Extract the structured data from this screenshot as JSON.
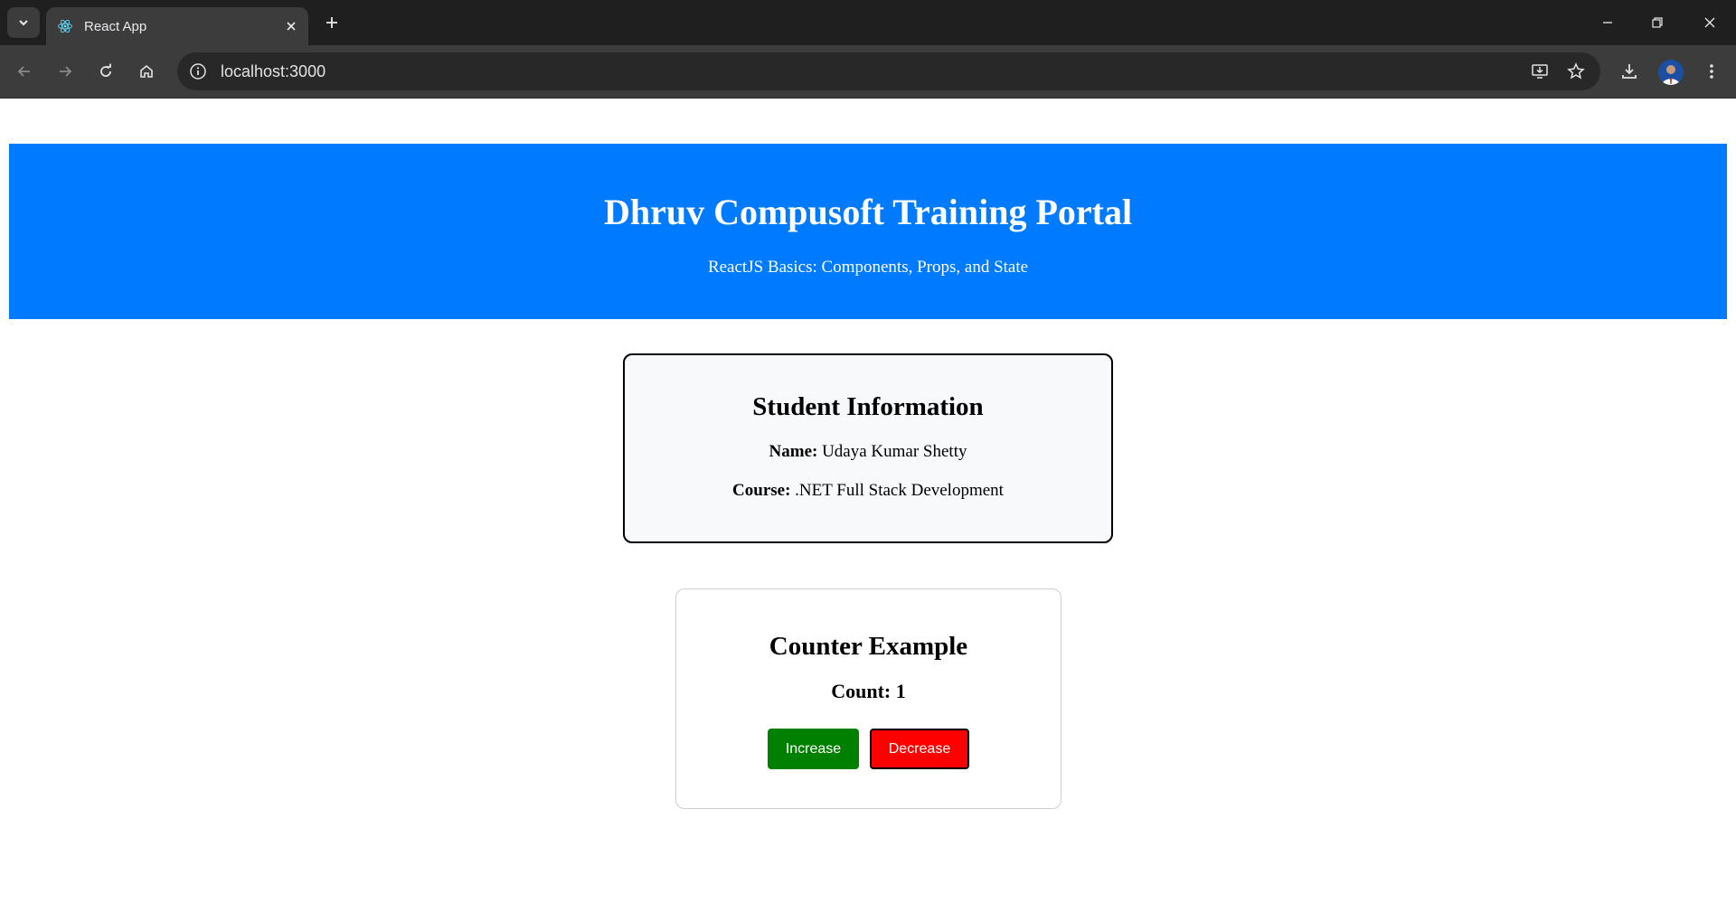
{
  "browser": {
    "tab_title": "React App",
    "url": "localhost:3000"
  },
  "header": {
    "title": "Dhruv Compusoft Training Portal",
    "subtitle": "ReactJS Basics: Components, Props, and State",
    "bg_color": "#007bff"
  },
  "student": {
    "heading": "Student Information",
    "name_label": "Name:",
    "name_value": "Udaya Kumar Shetty",
    "course_label": "Course:",
    "course_value": ".NET Full Stack Development"
  },
  "counter": {
    "heading": "Counter Example",
    "count_text": "Count: 1",
    "increase_label": "Increase",
    "decrease_label": "Decrease",
    "increase_color": "#008000",
    "decrease_color": "#ff0000"
  }
}
